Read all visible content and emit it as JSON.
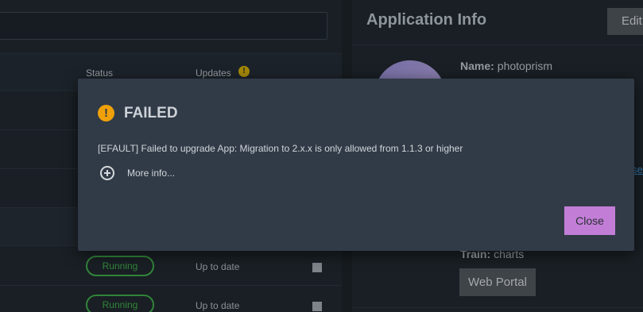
{
  "apps_table": {
    "headers": {
      "status": "Status",
      "updates": "Updates"
    },
    "updates_warning_icon": "exclamation-circle-icon",
    "rows": [
      {
        "status": "Running",
        "update": "Up to date"
      },
      {
        "status": "Running",
        "update": "Up to date"
      }
    ]
  },
  "application_info": {
    "title": "Application Info",
    "edit_label": "Edit",
    "name_key": "Name:",
    "name_value": "photoprism",
    "train_key": "Train:",
    "train_value": "charts",
    "web_portal_label": "Web Portal"
  },
  "dialog": {
    "icon": "warning-circle-icon",
    "title": "FAILED",
    "message": "[EFAULT] Failed to upgrade App: Migration to 2.x.x is only allowed from 1.1.3 or higher",
    "more_info_label": "More info...",
    "close_label": "Close"
  },
  "colors": {
    "running": "#3ca247",
    "warning": "#f0a10a",
    "close_button": "#c27ed6"
  }
}
